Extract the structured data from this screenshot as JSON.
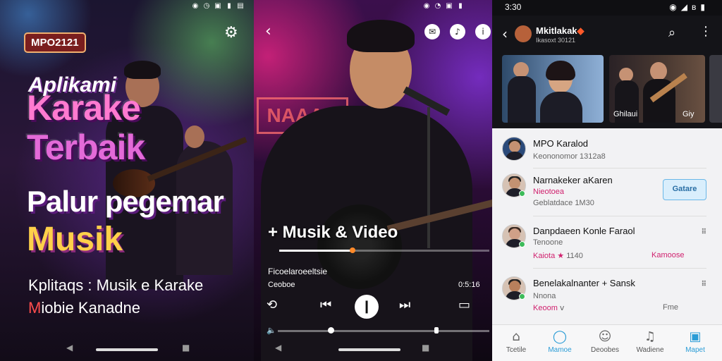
{
  "panel1": {
    "badge": "MPO2121",
    "title_line1": "Aplikami",
    "title_line2": "Karake",
    "title_line3": "Terbaik",
    "title_line4": "Palur pegemar",
    "title_line5": "Musik",
    "subtitle_line1": "Kplitaqs : Musik e Karake",
    "subtitle_line2_red": "M",
    "subtitle_line2_rest": "iobie Kanadne"
  },
  "panel2": {
    "section_title": "+ Musik & Video",
    "sign_text": "NAAAN",
    "track_name": "Ficoelaroeeltsie",
    "time_left": "Ceoboe",
    "time_right": "0:5:16",
    "progress": 0.35,
    "volume": 0.25
  },
  "panel3": {
    "status_time": "3:30",
    "channel_name": "Mkitlakak",
    "channel_handle": "Ikasoxt 30121",
    "thumb_caption": "Ghilaui",
    "thumb_caption2": "Giy",
    "list": [
      {
        "title": "MPO Karalod",
        "sub1": "Keononomor 1312a8"
      },
      {
        "title": "Narnakeker aKaren",
        "sub1": "Nieotoea",
        "sub2": "Geblatdace 1M30",
        "button": "Gatare"
      },
      {
        "title": "Danpdaeen Konle Faraol",
        "sub1": "Tenoone",
        "sub2_red": "Kaiota",
        "sub2_mid": "1140",
        "sub2_right": "Kamoose"
      },
      {
        "title": "Benelakalnanter + Sansk",
        "sub1": "Nnona",
        "sub2_red": "Keoom",
        "sub2_right": "Fme"
      }
    ],
    "tabs": [
      {
        "label": "Tcetile",
        "icon": "house-icon"
      },
      {
        "label": "Mamoe",
        "icon": "chat-icon"
      },
      {
        "label": "Deoobes",
        "icon": "people-icon"
      },
      {
        "label": "Wadiene",
        "icon": "bell-icon"
      },
      {
        "label": "Mapet",
        "icon": "store-icon"
      }
    ]
  }
}
